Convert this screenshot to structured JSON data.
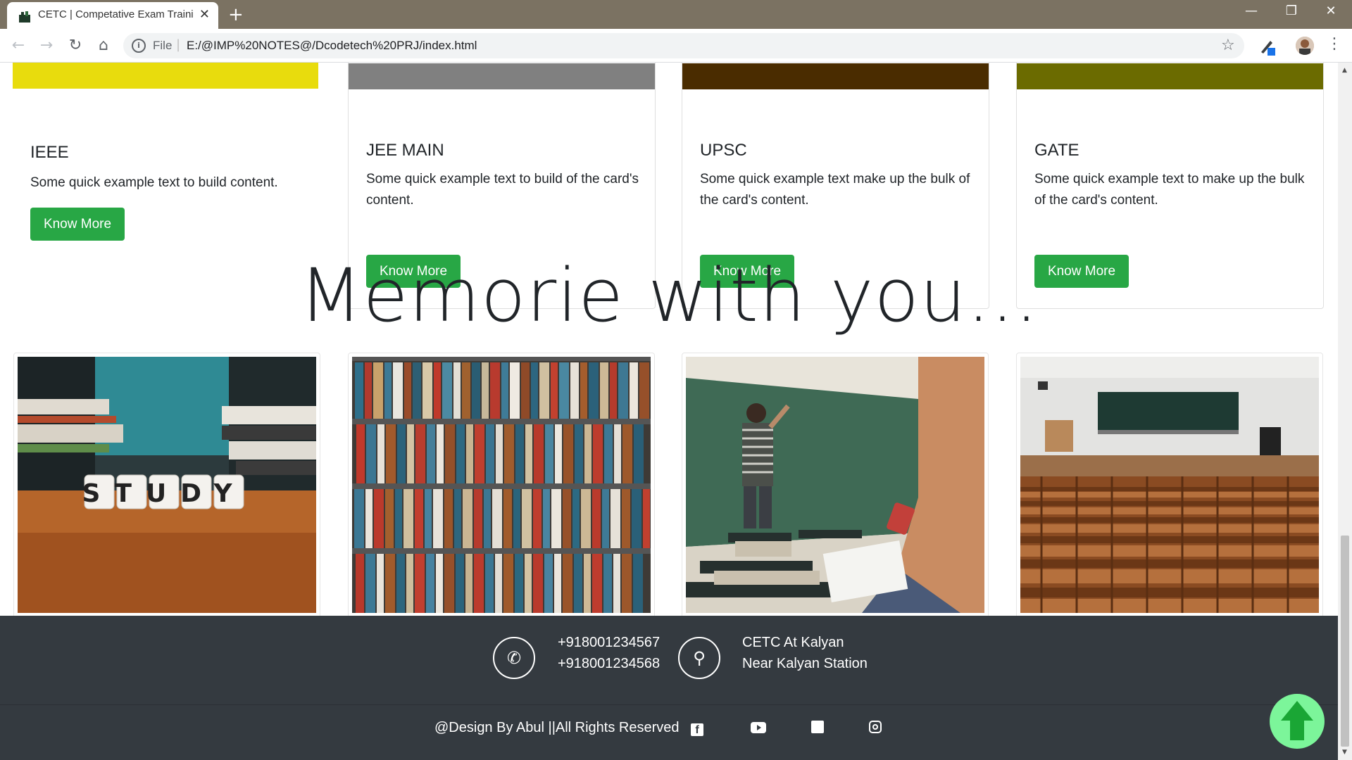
{
  "browser": {
    "tab_title": "CETC | Competative Exam Training",
    "tab_close": "✕",
    "new_tab": "+",
    "url_scheme": "File",
    "url": "E:/@IMP%20NOTES@/Dcodetech%20PRJ/index.html",
    "window_controls": {
      "minimize": "—",
      "maximize": "❐",
      "close": "✕"
    }
  },
  "icons": {
    "back": "back-arrow-icon",
    "forward": "forward-arrow-icon",
    "reload": "reload-icon",
    "home": "home-icon",
    "info": "info-icon",
    "star": "star-icon",
    "menu": "kebab-menu-icon"
  },
  "cards": [
    {
      "title": "IEEE",
      "text": "Some quick example text to build content.",
      "button": "Know More",
      "image_color": "#e8dc0d"
    },
    {
      "title": "JEE MAIN",
      "text": "Some quick example text to build of the card's content.",
      "button": "Know More",
      "image_color": "#808080"
    },
    {
      "title": "UPSC",
      "text": "Some quick example text make up the bulk of the card's content.",
      "button": "Know More",
      "image_color": "#4a2c00"
    },
    {
      "title": "GATE",
      "text": "Some quick example text to make up the bulk of the card's content.",
      "button": "Know More",
      "image_color": "#6b6b00"
    }
  ],
  "section_heading": "Memorie with you...",
  "gallery": {
    "photo1_word": "STUDY"
  },
  "footer": {
    "phones": [
      "+918001234567",
      "+918001234568"
    ],
    "address": [
      "CETC At Kalyan",
      "Near Kalyan Station"
    ],
    "copyright": "@Design By Abul ||All Rights Reserved",
    "social": [
      "facebook-icon",
      "youtube-icon",
      "twitter-icon",
      "instagram-icon"
    ]
  },
  "colors": {
    "accent_green": "#28a745",
    "footer_bg": "#343a40",
    "titlebar": "#7b7262",
    "to_top": "#7cf59a"
  }
}
